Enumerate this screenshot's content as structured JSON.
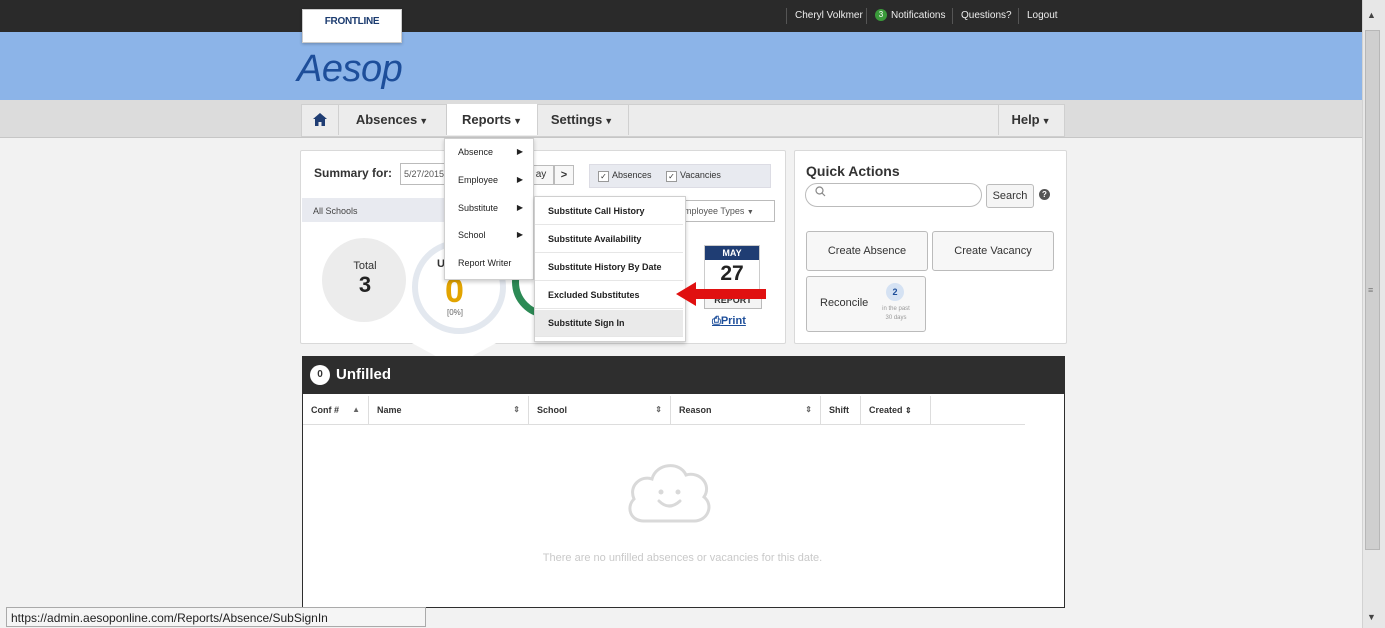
{
  "topbar": {
    "user": "Cheryl Volkmer",
    "notifications_count": "3",
    "notifications_label": "Notifications",
    "questions": "Questions?",
    "logout": "Logout"
  },
  "brand": {
    "frontline": "FRONTLINE",
    "logo": "Aesop"
  },
  "nav": {
    "absences": "Absences",
    "reports": "Reports",
    "settings": "Settings",
    "help": "Help"
  },
  "reports_menu": [
    "Absence",
    "Employee",
    "Substitute",
    "School",
    "Report Writer"
  ],
  "substitute_submenu": [
    "Substitute Call History",
    "Substitute Availability",
    "Substitute History By Date",
    "Excluded Substitutes",
    "Substitute Sign In"
  ],
  "summary": {
    "label": "Summary for:",
    "date": "5/27/2015",
    "today_fragment": "ay",
    "next": ">",
    "absences_label": "Absences",
    "vacancies_label": "Vacancies",
    "schools": "All Schools",
    "employee_types": "mployee Types",
    "total_label": "Total",
    "total_value": "3",
    "unfilled_label_fragment": "U",
    "unfilled_value": "0",
    "unfilled_pct": "[0%]",
    "cal_month": "MAY",
    "cal_day": "27",
    "report_fragment": "REPORT",
    "print": "Print"
  },
  "quick_actions": {
    "title": "Quick Actions",
    "search_button": "Search",
    "create_absence": "Create Absence",
    "create_vacancy": "Create Vacancy",
    "reconcile": "Reconcile",
    "reconcile_count": "2",
    "reconcile_sub1": "in the past",
    "reconcile_sub2": "30 days"
  },
  "unfilled": {
    "count": "0",
    "title": "Unfilled",
    "columns": [
      "Conf #",
      "Name",
      "School",
      "Reason",
      "Shift",
      "Created"
    ],
    "empty_message": "There are no unfilled absences or vacancies for this date."
  },
  "status_url": "https://admin.aesoponline.com/Reports/Absence/SubSignIn",
  "colors": {
    "banner": "#8cb4e8",
    "brand_blue": "#1d4e9a",
    "unfilled_header": "#2e2e2e",
    "arrow": "#e01010"
  }
}
